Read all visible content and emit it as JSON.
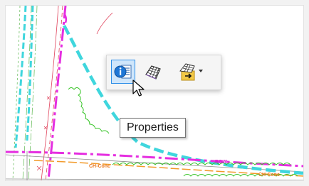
{
  "colors": {
    "cyan_dashed": "#3fd6dd",
    "magenta_dashdot": "#e52ee0",
    "green_vegetation": "#37c427",
    "orange_line": "#f29a2a",
    "red_linework": "#e0425b",
    "toolbar_selected_bg": "#cfe6fb",
    "toolbar_selected_border": "#2f8fe8"
  },
  "toolbar": {
    "buttons": [
      {
        "name": "properties",
        "icon": "info-list-icon",
        "selected": true
      },
      {
        "name": "mesh",
        "icon": "wireframe-surface-icon",
        "selected": false
      },
      {
        "name": "export",
        "icon": "surface-export-icon",
        "selected": false,
        "has_dropdown": true
      }
    ]
  },
  "tooltip": {
    "text": "Properties"
  },
  "cad_labels": [
    {
      "text": "CH-Conc"
    },
    {
      "text": "CH-Conc"
    },
    {
      "text": "ROW"
    }
  ]
}
